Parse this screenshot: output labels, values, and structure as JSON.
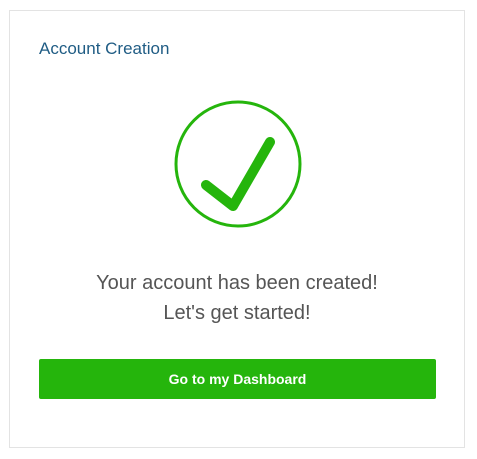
{
  "card": {
    "title": "Account Creation",
    "icon": "checkmark-circle-icon",
    "message_line1": "Your account has been created!",
    "message_line2": "Let's get started!",
    "button_label": "Go to my Dashboard"
  },
  "colors": {
    "title": "#1f5c84",
    "success": "#25b50c",
    "message_text": "#555555",
    "border": "#e3e3e3"
  }
}
